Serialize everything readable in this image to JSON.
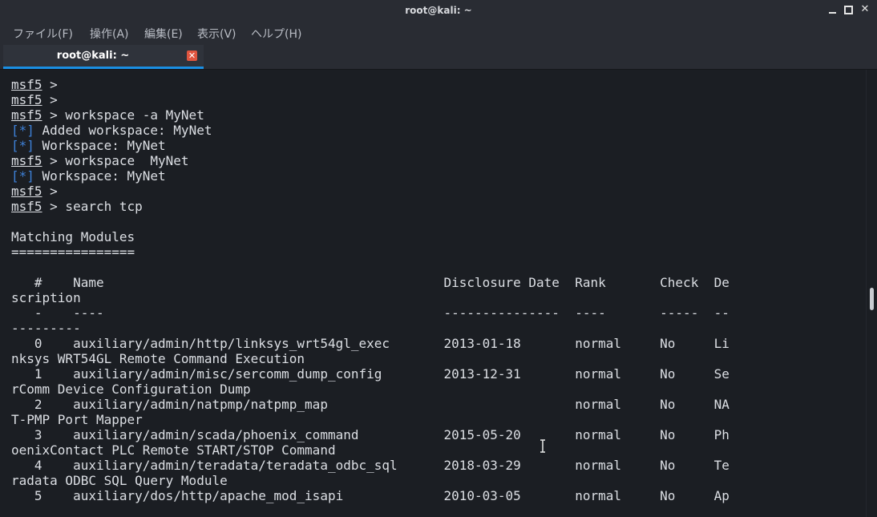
{
  "window": {
    "title": "root@kali: ~",
    "controls": {
      "minimize": "minimize",
      "maximize": "maximize",
      "close": "✕"
    }
  },
  "menu": [
    "ファイル(F)",
    "操作(A)",
    "編集(E)",
    "表示(V)",
    "ヘルプ(H)"
  ],
  "tab": {
    "label": "root@kali: ~",
    "close": "✕"
  },
  "colors": {
    "accent": "#1a8fe3",
    "info": "#3d80d7",
    "close": "#e0553f",
    "background": "#1b1e23"
  },
  "terminal": {
    "lines": [
      {
        "prompt": "msf5",
        "text": " >"
      },
      {
        "prompt": "msf5",
        "text": " >"
      },
      {
        "prompt": "msf5",
        "text": " > workspace -a MyNet"
      },
      {
        "info": "[*]",
        "text": " Added workspace: MyNet"
      },
      {
        "info": "[*]",
        "text": " Workspace: MyNet"
      },
      {
        "prompt": "msf5",
        "text": " > workspace  MyNet"
      },
      {
        "info": "[*]",
        "text": " Workspace: MyNet"
      },
      {
        "prompt": "msf5",
        "text": " >"
      },
      {
        "prompt": "msf5",
        "text": " > search tcp"
      },
      {
        "text": ""
      },
      {
        "text": "Matching Modules"
      },
      {
        "text": "================"
      },
      {
        "text": ""
      },
      {
        "text": "   #    Name                                            Disclosure Date  Rank       Check  De"
      },
      {
        "text": "scription"
      },
      {
        "text": "   -    ----                                            ---------------  ----       -----  --"
      },
      {
        "text": "---------"
      },
      {
        "text": "   0    auxiliary/admin/http/linksys_wrt54gl_exec       2013-01-18       normal     No     Li"
      },
      {
        "text": "nksys WRT54GL Remote Command Execution"
      },
      {
        "text": "   1    auxiliary/admin/misc/sercomm_dump_config        2013-12-31       normal     No     Se"
      },
      {
        "text": "rComm Device Configuration Dump"
      },
      {
        "text": "   2    auxiliary/admin/natpmp/natpmp_map                                normal     No     NA"
      },
      {
        "text": "T-PMP Port Mapper"
      },
      {
        "text": "   3    auxiliary/admin/scada/phoenix_command           2015-05-20       normal     No     Ph"
      },
      {
        "text": "oenixContact PLC Remote START/STOP Command"
      },
      {
        "text": "   4    auxiliary/admin/teradata/teradata_odbc_sql      2018-03-29       normal     No     Te"
      },
      {
        "text": "radata ODBC SQL Query Module"
      },
      {
        "text": "   5    auxiliary/dos/http/apache_mod_isapi             2010-03-05       normal     No     Ap"
      }
    ]
  }
}
